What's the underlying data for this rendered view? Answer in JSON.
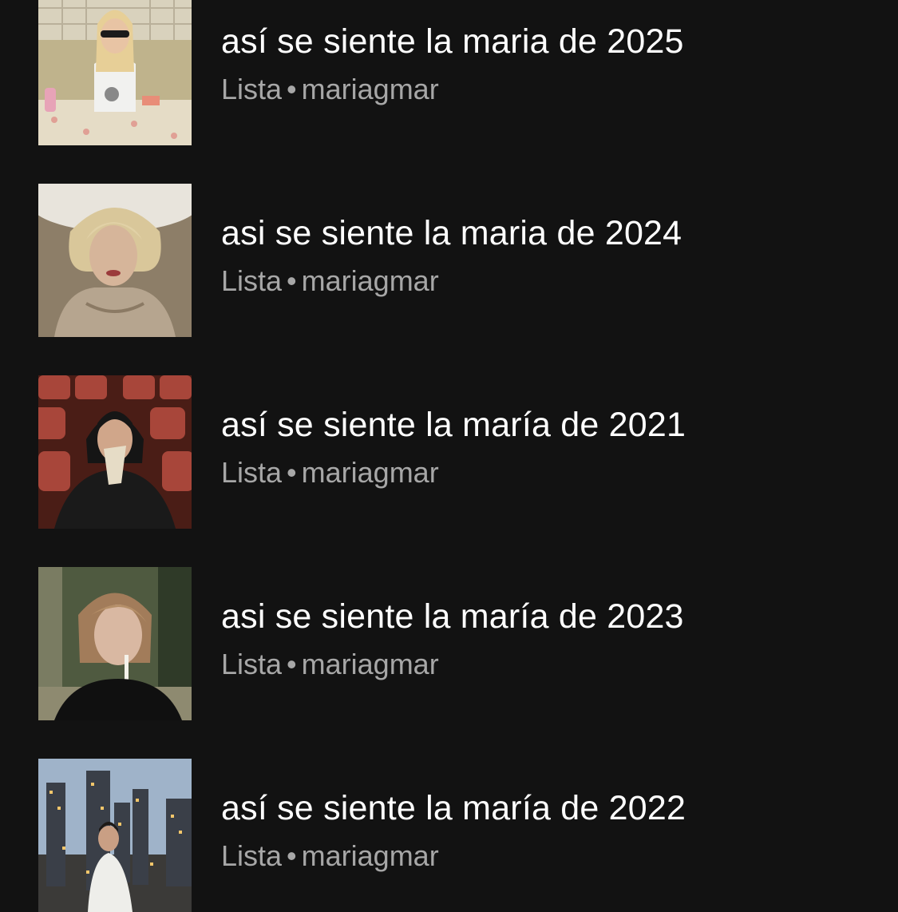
{
  "background_color": "#121212",
  "playlists": [
    {
      "title": "así se siente la maria de 2025",
      "type_label": "Lista",
      "separator": "•",
      "owner": "mariagmar",
      "cover_icon": "playlist-cover-kitchen-sunglasses-image"
    },
    {
      "title": "asi se siente la maria de 2024",
      "type_label": "Lista",
      "separator": "•",
      "owner": "mariagmar",
      "cover_icon": "playlist-cover-blonde-bathtub-image"
    },
    {
      "title": "así se siente la maría de 2021",
      "type_label": "Lista",
      "separator": "•",
      "owner": "mariagmar",
      "cover_icon": "playlist-cover-cinema-seats-image"
    },
    {
      "title": "asi se siente la maría de 2023",
      "type_label": "Lista",
      "separator": "•",
      "owner": "mariagmar",
      "cover_icon": "playlist-cover-cigarette-portrait-image"
    },
    {
      "title": "así se siente la maría de 2022",
      "type_label": "Lista",
      "separator": "•",
      "owner": "mariagmar",
      "cover_icon": "playlist-cover-city-skyline-image"
    }
  ]
}
